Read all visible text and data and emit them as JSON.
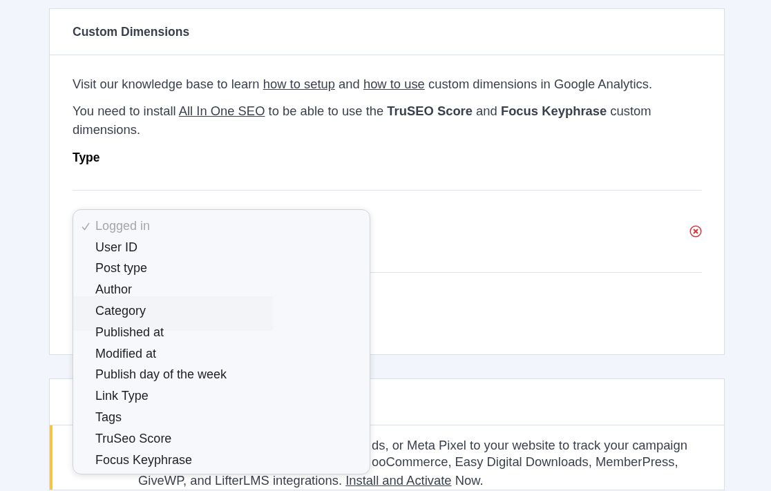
{
  "dimensions_card": {
    "title": "Custom Dimensions",
    "intro": [
      "Visit our knowledge base to learn ",
      {
        "link": "how to setup"
      },
      " and ",
      {
        "link": "how to use"
      },
      " custom dimensions in Google Analytics."
    ],
    "notice": "You need to install ",
    "notice_link": "All In One SEO",
    "notice_rest": " to be able to use the **TruSEO Score** and **Focus Keyphrase** custom dimensions.",
    "type_label": "Type"
  },
  "dropdown": {
    "options": [
      {
        "label": "Logged in",
        "checked": true,
        "disabled": true
      },
      {
        "label": "User ID",
        "checked": false,
        "disabled": false
      },
      {
        "label": "Post type",
        "checked": false,
        "disabled": false
      },
      {
        "label": "Author",
        "checked": false,
        "disabled": false
      },
      {
        "label": "Category",
        "checked": false,
        "disabled": false
      },
      {
        "label": "Published at",
        "checked": false,
        "disabled": false
      },
      {
        "label": "Modified at",
        "checked": false,
        "disabled": false
      },
      {
        "label": "Publish day of the week",
        "checked": false,
        "disabled": false
      },
      {
        "label": "Link Type",
        "checked": false,
        "disabled": false
      },
      {
        "label": "Tags",
        "checked": false,
        "disabled": false
      },
      {
        "label": "TruSeo Score",
        "checked": false,
        "disabled": false
      },
      {
        "label": "Focus Keyphrase",
        "checked": false,
        "disabled": false
      }
    ]
  },
  "promo_card": {
    "lines": [
      "ds, or Meta Pixel to your website to track your campaign",
      "ooCommerce, Easy Digital Downloads, MemberPress,"
    ],
    "last_line": "GiveWP, and LifterLMS integrations. ",
    "link": "Install and Activate",
    "tail": " Now."
  }
}
